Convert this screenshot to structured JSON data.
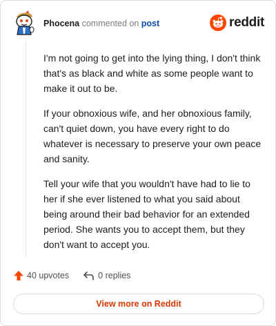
{
  "header": {
    "author": "Phocena",
    "verb": "commented on",
    "target": "post",
    "brand_name": "reddit",
    "brand_color": "#ff4500",
    "avatar_icon": "snoo-avatar-icon"
  },
  "comment": {
    "paragraphs": [
      "I'm not going to get into the lying thing, I don't think that's as black and white as some people want to make it out to be.",
      "If your obnoxious wife, and her obnoxious family, can't quiet down, you have every right to do whatever is necessary to preserve your own peace and sanity.",
      "Tell your wife that you wouldn't have had to lie to her if she ever listened to what you said about being around their bad behavior for an extended period. She wants you to accept them, but they don't want to accept you."
    ]
  },
  "actions": {
    "upvotes_label": "40 upvotes",
    "replies_label": "0 replies",
    "upvote_icon": "upvote-arrow-icon",
    "reply_icon": "reply-arrow-icon",
    "upvote_color": "#ff4500"
  },
  "footer": {
    "view_more_label": "View more on Reddit",
    "button_text_color": "#d93900"
  }
}
